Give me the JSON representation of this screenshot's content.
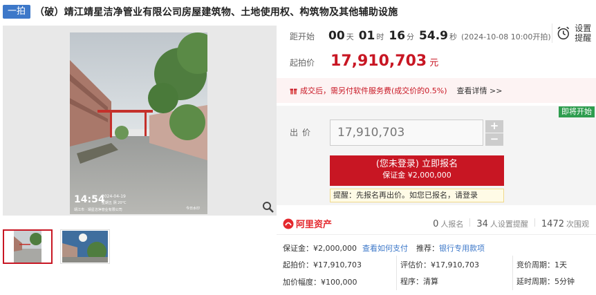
{
  "header": {
    "badge": "一拍",
    "title": "（破）靖江靖星洁净管业有限公司房屋建筑物、土地使用权、构筑物及其他辅助设施"
  },
  "photo": {
    "time": "14:54",
    "date": "2024-04-19",
    "weekday_temp": "星期五 阴 20°C",
    "location": "靖江市 · 靖星洁净管业有限公司",
    "brand": "今日水印"
  },
  "countdown": {
    "label": "距开始",
    "days": "00",
    "days_unit": "天",
    "hours": "01",
    "hours_unit": "时",
    "minutes": "16",
    "minutes_unit": "分",
    "seconds": "54.9",
    "seconds_unit": "秒",
    "start_note": "(2024-10-08 10:00开拍)"
  },
  "remind": {
    "label": "设置提醒"
  },
  "start_price": {
    "label": "起拍价",
    "value": "17,910,703",
    "unit": "元"
  },
  "fee": {
    "text": "成交后，需另付软件服务费(成交价的0.5%)",
    "link": "查看详情 >>"
  },
  "bid": {
    "tag": "即将开始",
    "label": "出价",
    "value": "17,910,703",
    "plus": "+",
    "minus": "−",
    "signup_main": "(您未登录) 立即报名",
    "signup_sub": "保证金 ¥2,000,000",
    "tip": "提醒：先报名再出价。如您已报名，请登录"
  },
  "ali": {
    "name": "阿里资产",
    "signups": "0",
    "signups_label": "人报名",
    "reminders": "34",
    "reminders_label": "人设置提醒",
    "views": "1472",
    "views_label": "次围观"
  },
  "details": {
    "deposit_label": "保证金：¥2,000,000",
    "how_to_pay": "查看如何支付",
    "recommend_label": "推荐：",
    "bank_link": "银行专用款项",
    "start_price": "起拍价：¥17,910,703",
    "assessed": "评估价：¥17,910,703",
    "cycle": "竞价周期：1天",
    "increment": "加价幅度：¥100,000",
    "procedure": "程序：清算",
    "extension": "延时周期：5分钟"
  },
  "colors": {
    "accent": "#c81623",
    "badge": "#3d78c9",
    "green": "#2e9d4f"
  }
}
